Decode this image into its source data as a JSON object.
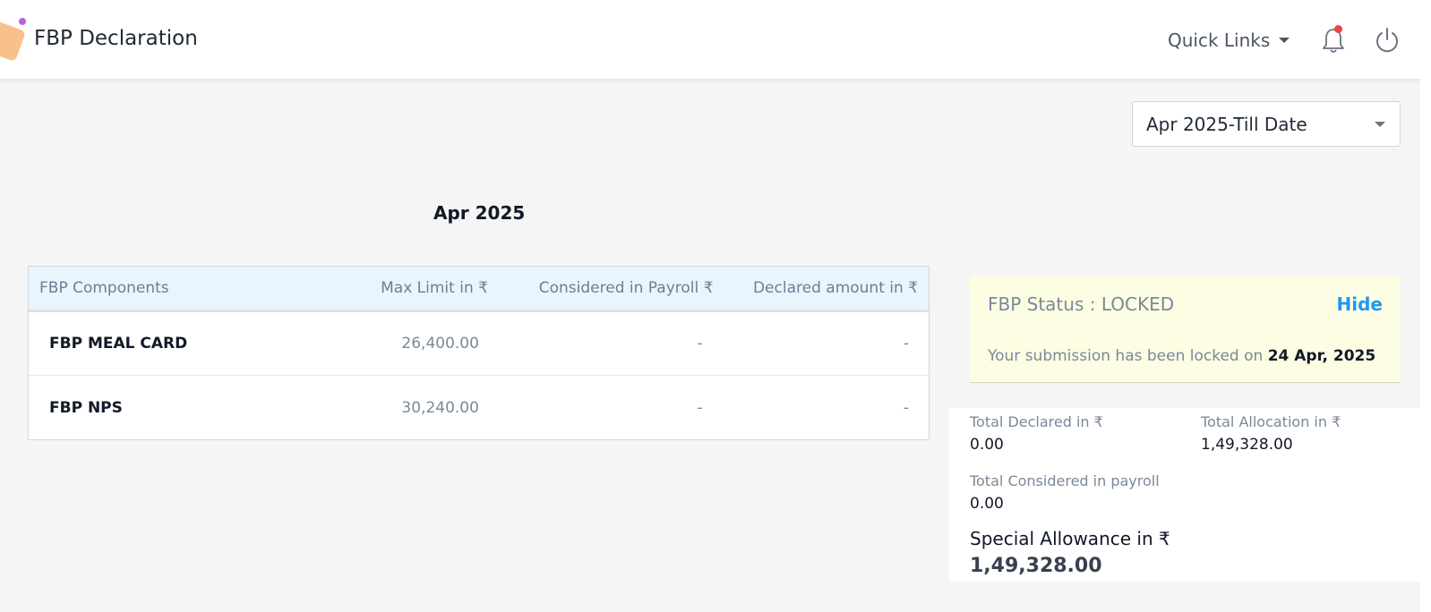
{
  "header": {
    "title": "FBP Declaration",
    "quick_links": "Quick Links",
    "icons": [
      "bell-icon",
      "power-icon"
    ],
    "notification_color": "#ef4444"
  },
  "period": {
    "selected": "Apr 2025-Till Date"
  },
  "month_title": "Apr 2025",
  "table": {
    "headers": [
      "FBP Components",
      "Max Limit in ₹",
      "Considered in Payroll ₹",
      "Declared amount in ₹"
    ],
    "rows": [
      {
        "component": "FBP MEAL CARD",
        "max_limit": "26,400.00",
        "considered": "-",
        "declared": "-"
      },
      {
        "component": "FBP NPS",
        "max_limit": "30,240.00",
        "considered": "-",
        "declared": "-"
      }
    ]
  },
  "status": {
    "title": "FBP Status : LOCKED",
    "hide": "Hide",
    "message": "Your submission has been locked on",
    "date": "24 Apr, 2025"
  },
  "totals": {
    "declared_label": "Total Declared in ₹",
    "declared_value": "0.00",
    "allocation_label": "Total Allocation in ₹",
    "allocation_value": "1,49,328.00",
    "considered_label": "Total Considered in payroll",
    "considered_value": "0.00",
    "special_label": "Special Allowance in ₹",
    "special_value": "1,49,328.00"
  },
  "colors": {
    "accent": "#2196f3",
    "status_bg": "#fdfde3",
    "table_header_bg": "#e8f5fc"
  }
}
